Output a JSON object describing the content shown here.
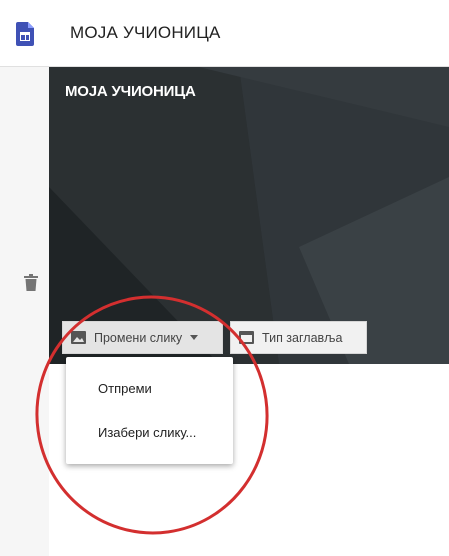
{
  "app": {
    "title": "МОЈА УЧИОНИЦА",
    "icon": "sites-doc-icon"
  },
  "sidebar": {
    "icon": "trash-icon"
  },
  "header": {
    "title": "МОЈА УЧИОНИЦА",
    "change_image_label": "Промени слику",
    "header_type_label": "Тип заглавља"
  },
  "menu": {
    "items": [
      {
        "label": "Отпреми"
      },
      {
        "label": "Изабери слику..."
      }
    ]
  },
  "colors": {
    "header_bg": "#262b2d",
    "app_icon": "#3f51b5",
    "annotation": "#d32f2f"
  }
}
